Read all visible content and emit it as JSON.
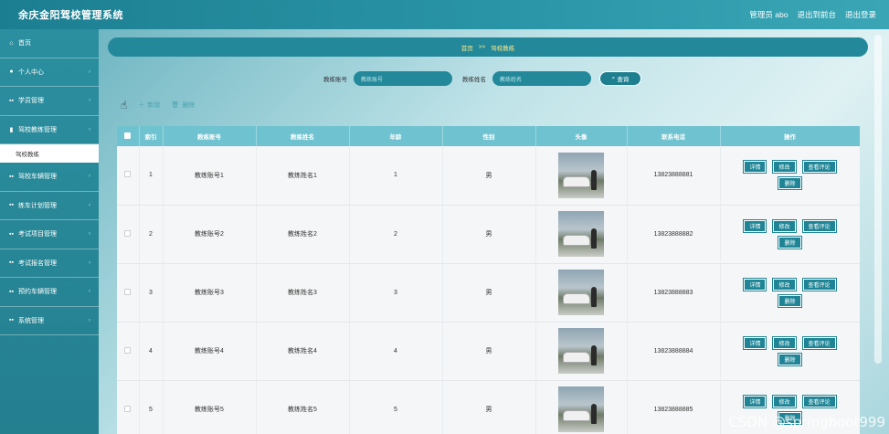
{
  "app": {
    "title": "余庆金阳驾校管理系统",
    "user_label": "管理员 abo",
    "back_label": "退出到前台",
    "logout_label": "退出登录"
  },
  "sidebar": {
    "items": [
      {
        "label": "首页",
        "icon": "home-icon"
      },
      {
        "label": "个人中心",
        "icon": "user-icon"
      },
      {
        "label": "学员管理",
        "icon": "grid-icon"
      },
      {
        "label": "驾校教练管理",
        "icon": "bar-icon"
      },
      {
        "label": "驾校车辆管理",
        "icon": "grid-icon"
      },
      {
        "label": "练车计划管理",
        "icon": "grid-icon"
      },
      {
        "label": "考试项目管理",
        "icon": "grid-icon"
      },
      {
        "label": "考试报名管理",
        "icon": "grid-icon"
      },
      {
        "label": "预约车辆管理",
        "icon": "grid-icon"
      },
      {
        "label": "系统管理",
        "icon": "grid-icon"
      }
    ],
    "active_sub": "驾校教练"
  },
  "breadcrumb": {
    "home": "首页",
    "sep": ">>",
    "current": "驾校教练"
  },
  "search": {
    "account_label": "教练账号",
    "account_placeholder": "教练账号",
    "name_label": "教练姓名",
    "name_placeholder": "教练姓名",
    "button_label": "查询"
  },
  "actions": {
    "add_label": "新增",
    "delete_label": "删除"
  },
  "table": {
    "headers": [
      "索引",
      "教练账号",
      "教练姓名",
      "年龄",
      "性别",
      "头像",
      "联系电话",
      "操作"
    ],
    "rows": [
      {
        "index": "1",
        "account": "教练账号1",
        "name": "教练姓名1",
        "age": "1",
        "gender": "男",
        "phone": "13823888881"
      },
      {
        "index": "2",
        "account": "教练账号2",
        "name": "教练姓名2",
        "age": "2",
        "gender": "男",
        "phone": "13823888882"
      },
      {
        "index": "3",
        "account": "教练账号3",
        "name": "教练姓名3",
        "age": "3",
        "gender": "男",
        "phone": "13823888883"
      },
      {
        "index": "4",
        "account": "教练账号4",
        "name": "教练姓名4",
        "age": "4",
        "gender": "男",
        "phone": "13823888884"
      },
      {
        "index": "5",
        "account": "教练账号5",
        "name": "教练姓名5",
        "age": "5",
        "gender": "男",
        "phone": "13823888885"
      }
    ],
    "op_labels": {
      "detail": "详情",
      "edit": "修改",
      "review": "查看评论",
      "delete": "删除"
    }
  },
  "watermark": "CSDN @springboot999"
}
